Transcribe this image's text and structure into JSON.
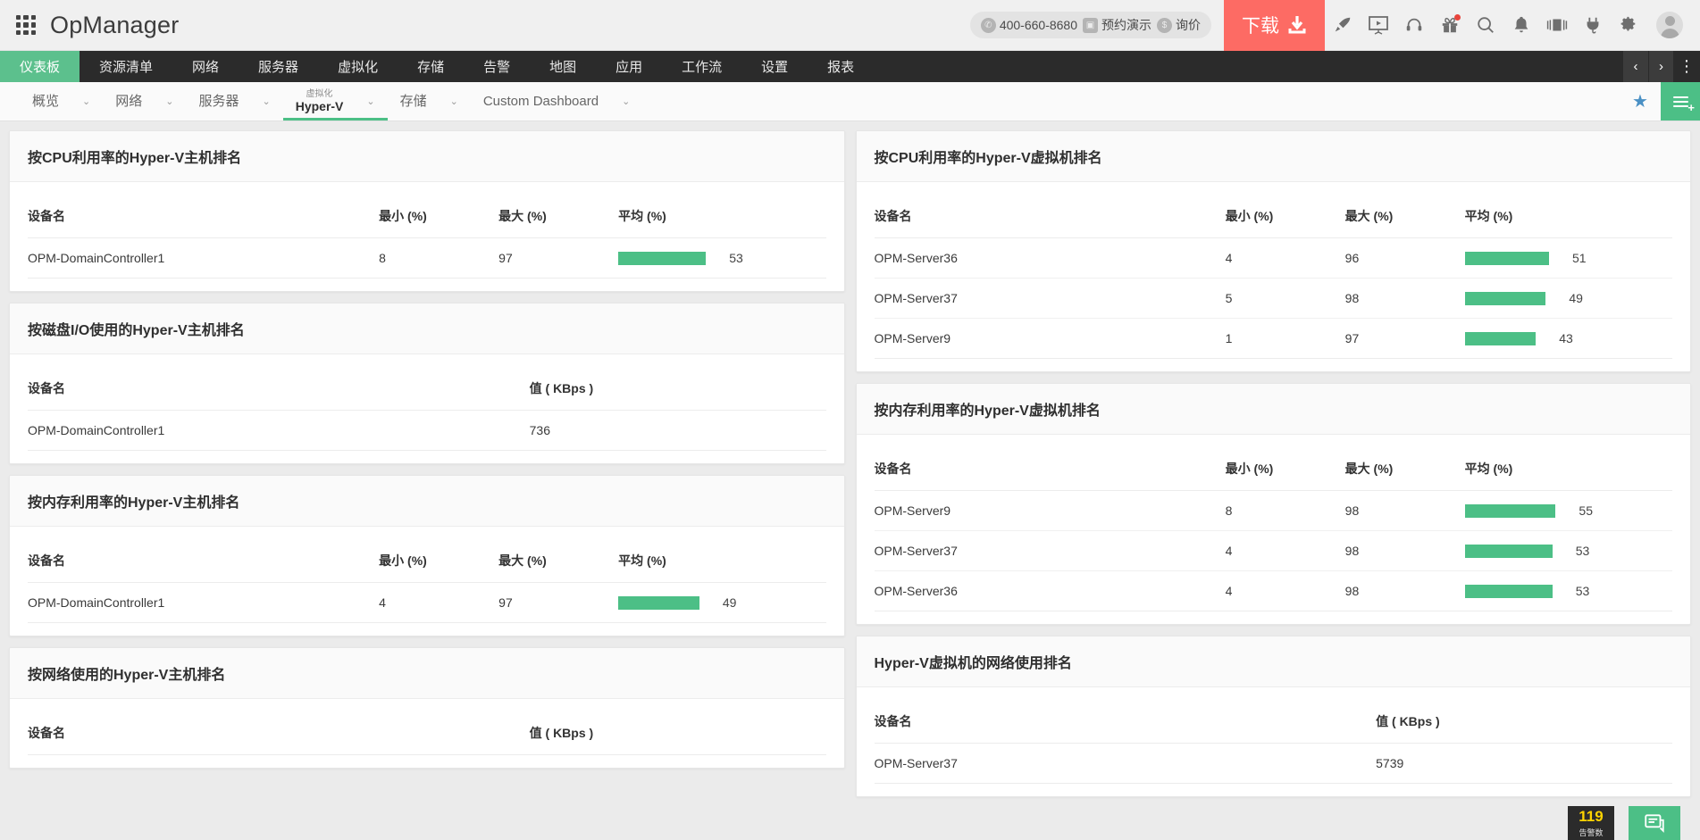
{
  "header": {
    "brand": "OpManager",
    "grid_icon": "apps-grid-icon",
    "contact": {
      "phone": "400-660-8680",
      "demo": "预约演示",
      "quote": "询价"
    },
    "download_label": "下载",
    "icons": [
      "rocket-icon",
      "presentation-play-icon",
      "headset-support-icon",
      "gift-icon",
      "search-icon",
      "bell-notification-icon",
      "server-rack-icon",
      "plug-power-icon",
      "gear-settings-icon"
    ],
    "avatar": "user-avatar"
  },
  "mainnav": {
    "tabs": [
      {
        "label": "仪表板",
        "active": true
      },
      {
        "label": "资源清单",
        "active": false
      },
      {
        "label": "网络",
        "active": false
      },
      {
        "label": "服务器",
        "active": false
      },
      {
        "label": "虚拟化",
        "active": false
      },
      {
        "label": "存储",
        "active": false
      },
      {
        "label": "告警",
        "active": false
      },
      {
        "label": "地图",
        "active": false
      },
      {
        "label": "应用",
        "active": false
      },
      {
        "label": "工作流",
        "active": false
      },
      {
        "label": "设置",
        "active": false
      },
      {
        "label": "报表",
        "active": false
      }
    ],
    "prev": "‹",
    "next": "›",
    "more": "⋮"
  },
  "subnav": {
    "items": [
      {
        "label": "概览",
        "sup": "",
        "caret": "⌄",
        "active": false
      },
      {
        "label": "网络",
        "sup": "",
        "caret": "⌄",
        "active": false
      },
      {
        "label": "服务器",
        "sup": "",
        "caret": "⌄",
        "active": false
      },
      {
        "label": "Hyper-V",
        "sup": "虚拟化",
        "caret": "⌄",
        "active": true
      },
      {
        "label": "存储",
        "sup": "",
        "caret": "⌄",
        "active": false
      },
      {
        "label": "Custom Dashboard",
        "sup": "",
        "caret": "⌄",
        "active": false
      }
    ],
    "star": "★",
    "fab_plus": "+"
  },
  "widgets": {
    "left": [
      {
        "title": "按CPU利用率的Hyper-V主机排名",
        "type": "minmaxavg",
        "columns": [
          "设备名",
          "最小 (%)",
          "最大 (%)",
          "平均 (%)"
        ],
        "rows": [
          {
            "name": "OPM-DomainController1",
            "min": "8",
            "max": "97",
            "avg": "53",
            "bar_pct": 53
          }
        ]
      },
      {
        "title": "按磁盘I/O使用的Hyper-V主机排名",
        "type": "value",
        "columns": [
          "设备名",
          "值 ( KBps )"
        ],
        "rows": [
          {
            "name": "OPM-DomainController1",
            "value": "736"
          }
        ]
      },
      {
        "title": "按内存利用率的Hyper-V主机排名",
        "type": "minmaxavg",
        "columns": [
          "设备名",
          "最小 (%)",
          "最大 (%)",
          "平均 (%)"
        ],
        "rows": [
          {
            "name": "OPM-DomainController1",
            "min": "4",
            "max": "97",
            "avg": "49",
            "bar_pct": 49
          }
        ]
      },
      {
        "title": "按网络使用的Hyper-V主机排名",
        "type": "value",
        "columns": [
          "设备名",
          "值 ( KBps )"
        ],
        "rows": []
      }
    ],
    "right": [
      {
        "title": "按CPU利用率的Hyper-V虚拟机排名",
        "type": "minmaxavg",
        "columns": [
          "设备名",
          "最小 (%)",
          "最大 (%)",
          "平均 (%)"
        ],
        "rows": [
          {
            "name": "OPM-Server36",
            "min": "4",
            "max": "96",
            "avg": "51",
            "bar_pct": 51
          },
          {
            "name": "OPM-Server37",
            "min": "5",
            "max": "98",
            "avg": "49",
            "bar_pct": 49
          },
          {
            "name": "OPM-Server9",
            "min": "1",
            "max": "97",
            "avg": "43",
            "bar_pct": 43
          }
        ]
      },
      {
        "title": "按内存利用率的Hyper-V虚拟机排名",
        "type": "minmaxavg",
        "columns": [
          "设备名",
          "最小 (%)",
          "最大 (%)",
          "平均 (%)"
        ],
        "rows": [
          {
            "name": "OPM-Server9",
            "min": "8",
            "max": "98",
            "avg": "55",
            "bar_pct": 55
          },
          {
            "name": "OPM-Server37",
            "min": "4",
            "max": "98",
            "avg": "53",
            "bar_pct": 53
          },
          {
            "name": "OPM-Server36",
            "min": "4",
            "max": "98",
            "avg": "53",
            "bar_pct": 53
          }
        ]
      },
      {
        "title": "Hyper-V虚拟机的网络使用排名",
        "type": "value",
        "columns": [
          "设备名",
          "值 ( KBps )"
        ],
        "rows": [
          {
            "name": "OPM-Server37",
            "value": "5739"
          }
        ]
      }
    ]
  },
  "overlays": {
    "alarm_count": "119",
    "alarm_label": "告警数",
    "chat_icon": "chat-bubble-icon"
  },
  "colors": {
    "accent_green": "#4cbf86",
    "nav_active_green": "#5cc08d",
    "download_red": "#fd6b64",
    "nav_dark": "#2b2b2b",
    "alarm_yellow": "#ffd400"
  }
}
